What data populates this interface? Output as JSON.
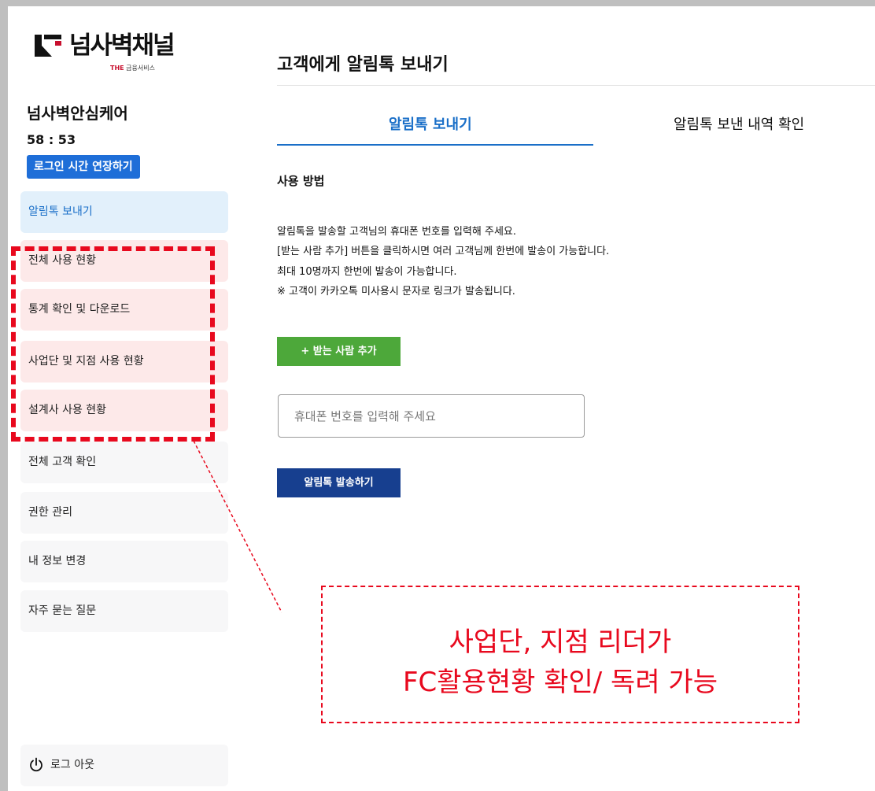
{
  "sidebar": {
    "logo_text": "넘사벽채널",
    "logo_sub_the": "THE",
    "logo_sub_rest": "금융서비스",
    "brand_name": "넘사벽안심케어",
    "timer": "58 : 53",
    "extend_button": "로그인 시간 연장하기",
    "items": [
      {
        "label": "알림톡 보내기"
      },
      {
        "label": "전체 사용 현황"
      },
      {
        "label": "통계 확인 및 다운로드"
      },
      {
        "label": "사업단 및 지점 사용 현황"
      },
      {
        "label": "설계사 사용 현황"
      },
      {
        "label": "전체 고객 확인"
      },
      {
        "label": "권한 관리"
      },
      {
        "label": "내 정보 변경"
      },
      {
        "label": "자주 묻는 질문"
      }
    ],
    "logout_label": "로그 아웃"
  },
  "main": {
    "title": "고객에게 알림톡 보내기",
    "tabs": [
      {
        "label": "알림톡 보내기"
      },
      {
        "label": "알림톡 보낸 내역 확인"
      }
    ],
    "usage_heading": "사용 방법",
    "instructions": [
      "알림톡을 발송할 고객님의 휴대폰 번호를 입력해 주세요.",
      "[받는 사람 추가] 버튼을 클릭하시면 여러 고객님께 한번에 발송이 가능합니다.",
      "최대 10명까지 한번에 발송이 가능합니다.",
      "※ 고객이 카카오톡 미사용시 문자로 링크가 발송됩니다."
    ],
    "add_recipient_button": "+ 받는 사람 추가",
    "phone_placeholder": "휴대폰 번호를 입력해 주세요",
    "send_button": "알림톡 발송하기"
  },
  "callout": {
    "line1": "사업단, 지점 리더가",
    "line2": "FC활용현황 확인/ 독려 가능"
  },
  "colors": {
    "accent_blue": "#1a6fc8",
    "green_button": "#4da83a",
    "navy_button": "#173f8f",
    "highlight_red": "#e8091e"
  },
  "icons": [
    "logo-mark-icon",
    "power-icon"
  ]
}
